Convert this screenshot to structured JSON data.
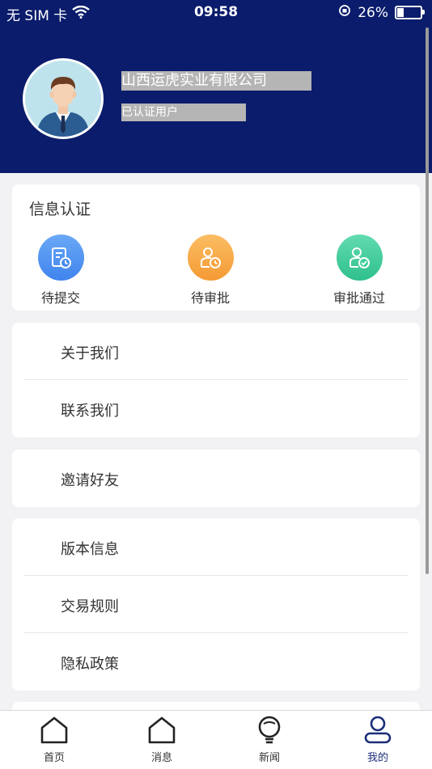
{
  "status_bar": {
    "carrier": "无 SIM 卡",
    "time": "09:58",
    "battery_percent": "26%",
    "battery_level": 0.26
  },
  "profile": {
    "company_name": "山西运虎实业有限公司",
    "sub_text": "已认证用户"
  },
  "auth": {
    "title": "信息认证",
    "items": [
      {
        "label": "待提交",
        "icon": "document-clock-icon",
        "color": "#4a8ef0"
      },
      {
        "label": "待审批",
        "icon": "user-clock-icon",
        "color": "#f7a340"
      },
      {
        "label": "审批通过",
        "icon": "user-check-icon",
        "color": "#3fcf9a"
      }
    ]
  },
  "menu_groups": [
    {
      "items": [
        {
          "label": "关于我们"
        },
        {
          "label": "联系我们"
        }
      ]
    },
    {
      "items": [
        {
          "label": "邀请好友"
        }
      ]
    },
    {
      "items": [
        {
          "label": "版本信息"
        },
        {
          "label": "交易规则"
        },
        {
          "label": "隐私政策"
        }
      ]
    }
  ],
  "tabbar": {
    "items": [
      {
        "label": "首页",
        "icon": "home-icon",
        "active": false
      },
      {
        "label": "消息",
        "icon": "message-house-icon",
        "active": false
      },
      {
        "label": "新闻",
        "icon": "lightbulb-icon",
        "active": false
      },
      {
        "label": "我的",
        "icon": "profile-icon",
        "active": true
      }
    ]
  },
  "colors": {
    "header_bg": "#0a1c6b",
    "page_bg": "#f2f2f4",
    "active_tab": "#1c2e7a"
  }
}
